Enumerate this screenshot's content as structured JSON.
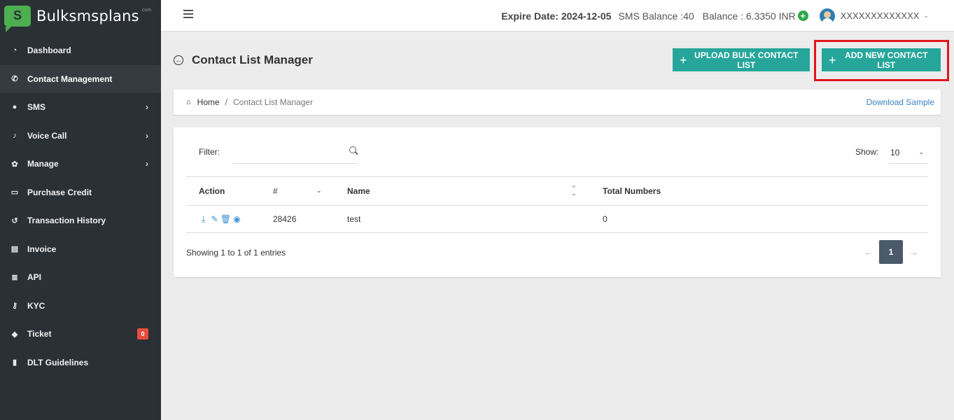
{
  "brand": {
    "logo_letter": "S",
    "name": "Bulksmsplans",
    "sup": ".com"
  },
  "sidebar": {
    "items": [
      {
        "label": "Dashboard",
        "icon": "dashboard-icon",
        "glyph": "◔"
      },
      {
        "label": "Contact Management",
        "icon": "phone-icon",
        "glyph": "✆",
        "active": true
      },
      {
        "label": "SMS",
        "icon": "comment-icon",
        "glyph": "●",
        "chevron": "›"
      },
      {
        "label": "Voice Call",
        "icon": "microphone-icon",
        "glyph": "♪",
        "chevron": "›"
      },
      {
        "label": "Manage",
        "icon": "gear-icon",
        "glyph": "✿",
        "chevron": "›"
      },
      {
        "label": "Purchase Credit",
        "icon": "credit-card-icon",
        "glyph": "▭"
      },
      {
        "label": "Transaction History",
        "icon": "history-icon",
        "glyph": "↺"
      },
      {
        "label": "Invoice",
        "icon": "pdf-file-icon",
        "glyph": "▤"
      },
      {
        "label": "API",
        "icon": "database-icon",
        "glyph": "≣"
      },
      {
        "label": "KYC",
        "icon": "key-icon",
        "glyph": "⚷"
      },
      {
        "label": "Ticket",
        "icon": "ticket-icon",
        "glyph": "◆",
        "badge": "0"
      },
      {
        "label": "DLT Guidelines",
        "icon": "book-icon",
        "glyph": "▮"
      }
    ]
  },
  "header": {
    "expire": "Expire Date: 2024-12-05",
    "sms_balance": "SMS Balance :40",
    "balance": "Balance : 6.3350 INR",
    "add_balance": "+",
    "username": "XXXXXXXXXXXXX",
    "chevron": "⌄"
  },
  "page": {
    "back_glyph": "←",
    "title": "Contact List Manager",
    "upload_button": "UPLOAD BULK CONTACT LIST",
    "add_button": "ADD NEW CONTACT LIST",
    "plus": "+"
  },
  "breadcrumb": {
    "home_glyph": "⌂",
    "home": "Home",
    "separator": "/",
    "current": "Contact List Manager",
    "download_link": "Download Sample"
  },
  "table": {
    "filter_label": "Filter:",
    "filter_value": "",
    "show_label": "Show:",
    "show_value": "10",
    "show_chevron": "⌄",
    "columns": {
      "action": "Action",
      "id": "#",
      "name": "Name",
      "total": "Total Numbers"
    },
    "sort_desc": "⌄",
    "sort_both_up": "⌃",
    "sort_both_down": "⌄",
    "rows": [
      {
        "id": "28426",
        "name": "test",
        "total": "0"
      }
    ],
    "action_glyphs": {
      "download": "⤓",
      "edit": "✎",
      "delete": "🗑",
      "view": "◉"
    },
    "showing": "Showing 1 to 1 of 1 entries",
    "pager": {
      "prev": "←",
      "page": "1",
      "next": "→"
    }
  },
  "colors": {
    "sidebar_bg": "#2b3035",
    "accent_teal": "#26a69a",
    "highlight_red": "#e3141c",
    "link_blue": "#3b82c4",
    "badge_red": "#e74c3c"
  }
}
